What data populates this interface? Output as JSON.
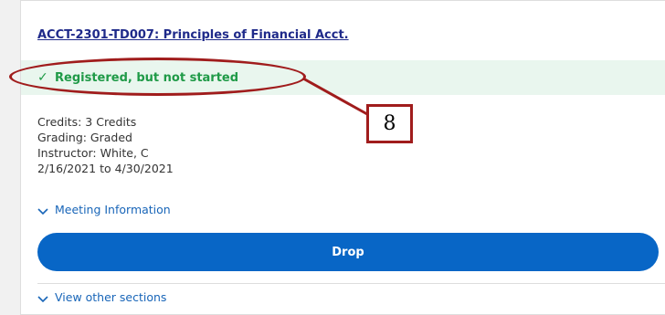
{
  "course": {
    "title": "ACCT-2301-TD007: Principles of Financial Acct."
  },
  "status": {
    "icon": "check-icon",
    "text": "Registered, but not started",
    "color": "#1f9a47",
    "background": "#e9f6ee"
  },
  "details": {
    "credits": "Credits: 3 Credits",
    "grading": "Grading: Graded",
    "instructor": "Instructor: White, C",
    "dates": "2/16/2021 to 4/30/2021"
  },
  "meeting_toggle": {
    "icon": "chevron-down-icon",
    "label": "Meeting Information"
  },
  "drop_button": {
    "label": "Drop",
    "color": "#0866c6"
  },
  "other_sections_toggle": {
    "icon": "chevron-down-icon",
    "label": "View other sections"
  },
  "annotation": {
    "number": "8",
    "color": "#a01c1c"
  }
}
